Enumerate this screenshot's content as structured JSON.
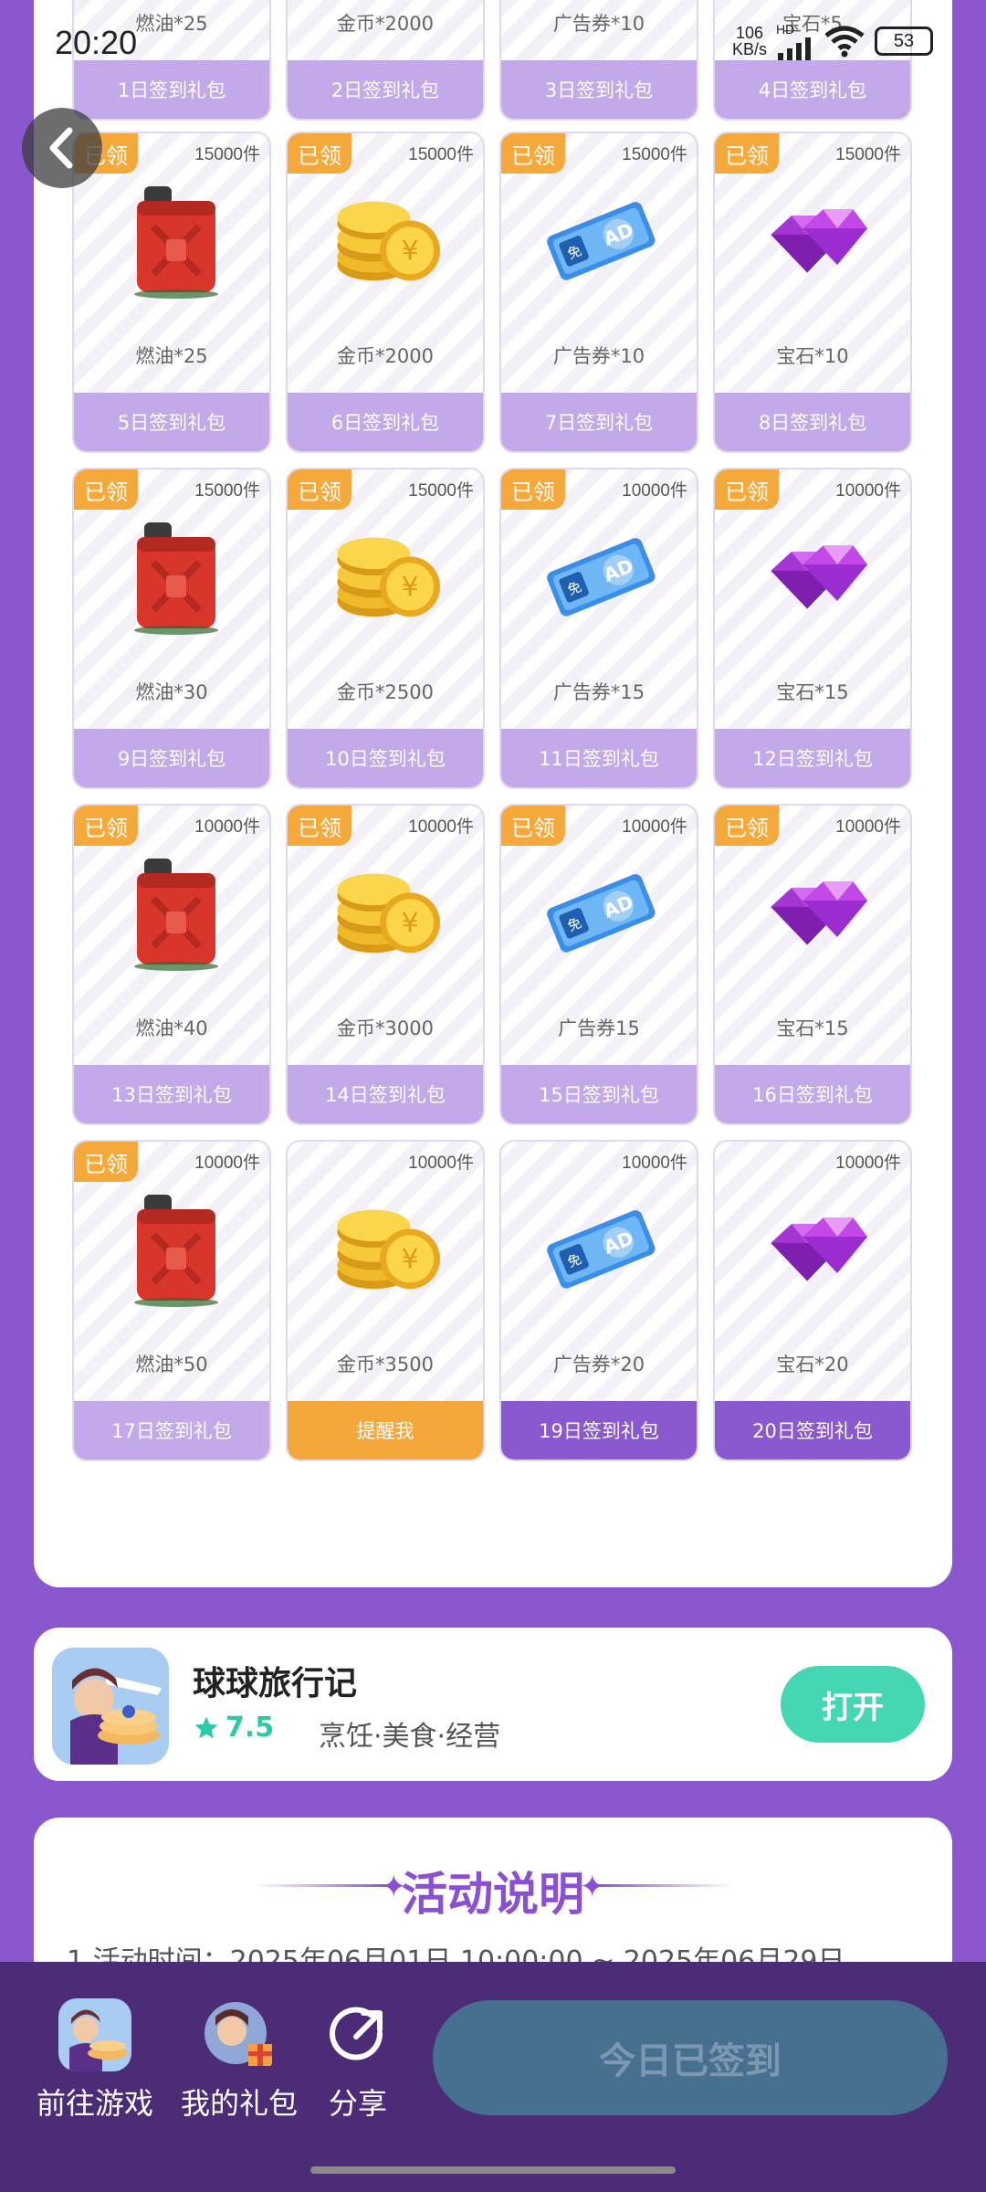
{
  "status": {
    "time": "20:20",
    "net_speed_value": "106",
    "net_speed_unit": "KB/s",
    "signal_label": "HD",
    "battery": "53"
  },
  "cards": [
    {
      "claimed": false,
      "stock": "",
      "item": "燃油*25",
      "type": "fuel",
      "button": "1日签到礼包",
      "button_style": "light"
    },
    {
      "claimed": false,
      "stock": "",
      "item": "金币*2000",
      "type": "coin",
      "button": "2日签到礼包",
      "button_style": "light"
    },
    {
      "claimed": false,
      "stock": "",
      "item": "广告券*10",
      "type": "ad",
      "button": "3日签到礼包",
      "button_style": "light"
    },
    {
      "claimed": false,
      "stock": "",
      "item": "宝石*5",
      "type": "gem",
      "button": "4日签到礼包",
      "button_style": "light"
    },
    {
      "claimed": true,
      "stock": "15000件",
      "item": "燃油*25",
      "type": "fuel",
      "button": "5日签到礼包",
      "button_style": "light"
    },
    {
      "claimed": true,
      "stock": "15000件",
      "item": "金币*2000",
      "type": "coin",
      "button": "6日签到礼包",
      "button_style": "light"
    },
    {
      "claimed": true,
      "stock": "15000件",
      "item": "广告券*10",
      "type": "ad",
      "button": "7日签到礼包",
      "button_style": "light"
    },
    {
      "claimed": true,
      "stock": "15000件",
      "item": "宝石*10",
      "type": "gem",
      "button": "8日签到礼包",
      "button_style": "light"
    },
    {
      "claimed": true,
      "stock": "15000件",
      "item": "燃油*30",
      "type": "fuel",
      "button": "9日签到礼包",
      "button_style": "light"
    },
    {
      "claimed": true,
      "stock": "15000件",
      "item": "金币*2500",
      "type": "coin",
      "button": "10日签到礼包",
      "button_style": "light"
    },
    {
      "claimed": true,
      "stock": "10000件",
      "item": "广告券*15",
      "type": "ad",
      "button": "11日签到礼包",
      "button_style": "light"
    },
    {
      "claimed": true,
      "stock": "10000件",
      "item": "宝石*15",
      "type": "gem",
      "button": "12日签到礼包",
      "button_style": "light"
    },
    {
      "claimed": true,
      "stock": "10000件",
      "item": "燃油*40",
      "type": "fuel",
      "button": "13日签到礼包",
      "button_style": "light"
    },
    {
      "claimed": true,
      "stock": "10000件",
      "item": "金币*3000",
      "type": "coin",
      "button": "14日签到礼包",
      "button_style": "light"
    },
    {
      "claimed": true,
      "stock": "10000件",
      "item": "广告券15",
      "type": "ad",
      "button": "15日签到礼包",
      "button_style": "light"
    },
    {
      "claimed": true,
      "stock": "10000件",
      "item": "宝石*15",
      "type": "gem",
      "button": "16日签到礼包",
      "button_style": "light"
    },
    {
      "claimed": true,
      "stock": "10000件",
      "item": "燃油*50",
      "type": "fuel",
      "button": "17日签到礼包",
      "button_style": "light"
    },
    {
      "claimed": false,
      "stock": "10000件",
      "item": "金币*3500",
      "type": "coin",
      "button": "提醒我",
      "button_style": "orange"
    },
    {
      "claimed": false,
      "stock": "10000件",
      "item": "广告券*20",
      "type": "ad",
      "button": "19日签到礼包",
      "button_style": "purple"
    },
    {
      "claimed": false,
      "stock": "10000件",
      "item": "宝石*20",
      "type": "gem",
      "button": "20日签到礼包",
      "button_style": "purple"
    }
  ],
  "claimed_label": "已领",
  "ad_icon_text": "AD",
  "ad_side_text": "免",
  "game": {
    "title": "球球旅行记",
    "rating": "7.5",
    "tags": "烹饪·美食·经营",
    "open_label": "打开"
  },
  "activity": {
    "title": "活动说明",
    "line1": "1.活动时间：2025年06月01日 10:00:00 ~ 2025年06月29日"
  },
  "bottom_nav": {
    "goto_game": "前往游戏",
    "my_gifts": "我的礼包",
    "share": "分享",
    "checkin_label": "今日已签到"
  },
  "colors": {
    "background": "#8a57cf",
    "card_button_light": "#c3a8ea",
    "card_button_purple": "#8a58cf",
    "remind_orange": "#f4a83c",
    "claimed_badge": "#f6a93b",
    "open_button": "#45d6b4",
    "bottom_bar": "#4c2c77",
    "checkin_disabled": "#46708f"
  }
}
